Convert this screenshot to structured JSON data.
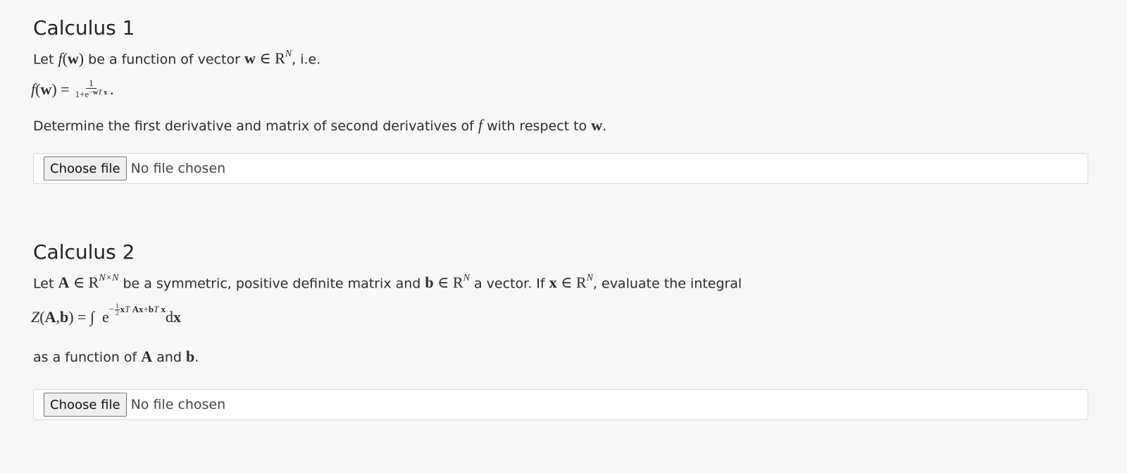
{
  "calc1": {
    "title": "Calculus 1",
    "intro_a": "Let ",
    "intro_b": " be a function of vector ",
    "intro_c": ", i.e.",
    "question_a": "Determine the first derivative and matrix of second derivatives of ",
    "question_b": " with respect to ",
    "question_c": ".",
    "file_button": "Choose file",
    "file_status": "No file chosen"
  },
  "calc2": {
    "title": "Calculus 2",
    "intro_a": "Let ",
    "intro_b": " be a symmetric, positive definite matrix and ",
    "intro_c": " a vector. If ",
    "intro_d": ", evaluate the integral",
    "closing_a": "as a function of ",
    "closing_b": " and ",
    "closing_c": ".",
    "file_button": "Choose file",
    "file_status": "No file chosen"
  }
}
